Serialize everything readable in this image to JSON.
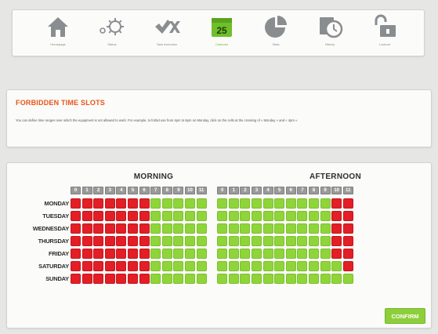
{
  "nav": {
    "items": [
      {
        "label": "Homepage",
        "icon": "home-icon"
      },
      {
        "label": "Status",
        "icon": "gear-icon"
      },
      {
        "label": "Task execution",
        "icon": "check-cross-icon"
      },
      {
        "label": "Calendar",
        "icon": "calendar-icon",
        "badge": "25",
        "active": true
      },
      {
        "label": "Stats",
        "icon": "pie-chart-icon"
      },
      {
        "label": "History",
        "icon": "clock-icon"
      },
      {
        "label": "Lockout",
        "icon": "padlock-icon"
      }
    ]
  },
  "info": {
    "title": "FORBIDDEN TIME SLOTS",
    "description": "You can define time ranges over which the equipment is not allowed to work. For example, to forbid use from 4pm to 6pm on Monday, click on the cells at the crossing of « Monday » and « 4pm »."
  },
  "slots": {
    "morning_label": "MORNING",
    "afternoon_label": "AFTERNOON",
    "morning_hours": [
      "0",
      "1",
      "2",
      "3",
      "4",
      "5",
      "6",
      "7",
      "8",
      "9",
      "10",
      "11"
    ],
    "afternoon_hours": [
      "0",
      "1",
      "2",
      "3",
      "4",
      "5",
      "6",
      "7",
      "8",
      "9",
      "10",
      "11"
    ],
    "days": [
      {
        "name": "MONDAY",
        "forbidden_hours": [
          0,
          1,
          2,
          3,
          4,
          5,
          6,
          22,
          23
        ]
      },
      {
        "name": "TUESDAY",
        "forbidden_hours": [
          0,
          1,
          2,
          3,
          4,
          5,
          6,
          22,
          23
        ]
      },
      {
        "name": "WEDNESDAY",
        "forbidden_hours": [
          0,
          1,
          2,
          3,
          4,
          5,
          6,
          22,
          23
        ]
      },
      {
        "name": "THURSDAY",
        "forbidden_hours": [
          0,
          1,
          2,
          3,
          4,
          5,
          6,
          22,
          23
        ]
      },
      {
        "name": "FRIDAY",
        "forbidden_hours": [
          0,
          1,
          2,
          3,
          4,
          5,
          6,
          22,
          23
        ]
      },
      {
        "name": "SATURDAY",
        "forbidden_hours": [
          0,
          1,
          2,
          3,
          4,
          5,
          6,
          23
        ]
      },
      {
        "name": "SUNDAY",
        "forbidden_hours": [
          0,
          1,
          2,
          3,
          4,
          5,
          6
        ]
      }
    ]
  },
  "confirm_label": "CONFIRM",
  "colors": {
    "forbidden": "#e41e26",
    "allowed": "#8fd53a",
    "accent_orange": "#e85416",
    "active_green": "#6fbf2a"
  }
}
